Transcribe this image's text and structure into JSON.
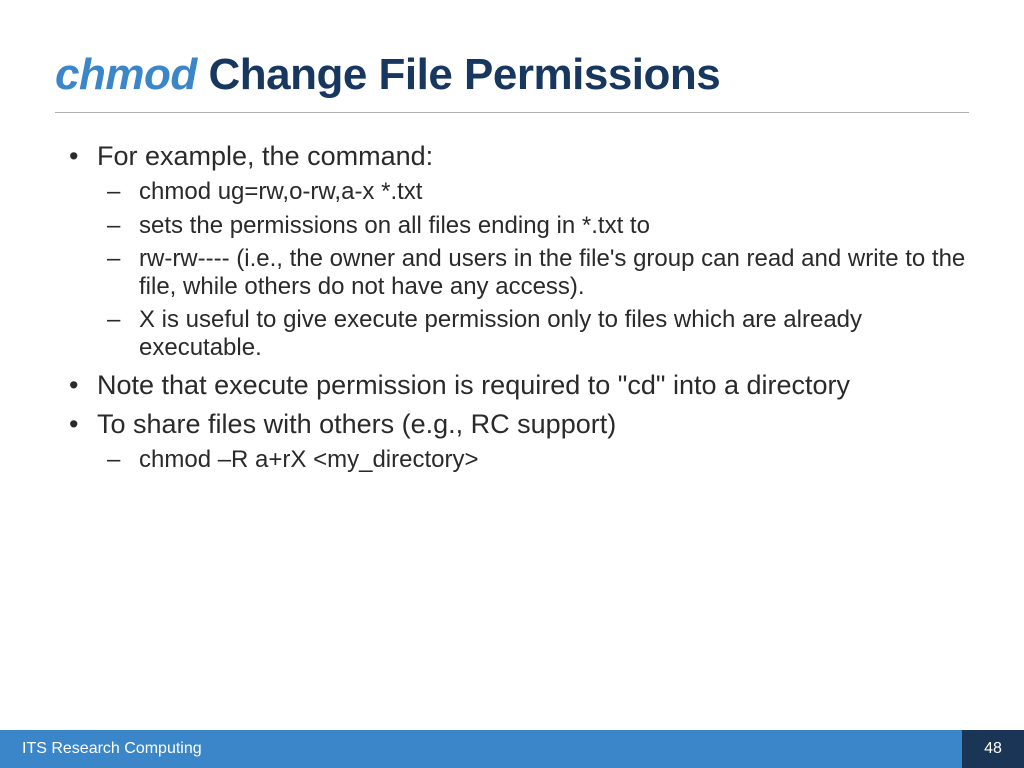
{
  "title": {
    "cmd": "chmod",
    "rest": " Change File Permissions"
  },
  "bullets": {
    "item1": {
      "text": "For example, the command:",
      "sub1": " chmod ug=rw,o-rw,a-x *.txt",
      "sub2": "sets the permissions on all files ending in *.txt to",
      "sub3": "rw-rw---- (i.e., the owner and users in the file's group can read and write to the file, while others do not have any access).",
      "sub4": "X is useful to give execute permission only to files which are already executable."
    },
    "item2": {
      "text": "Note that execute permission is required to \"cd\" into a directory"
    },
    "item3": {
      "text": "To share files with others (e.g., RC support)",
      "sub1": "chmod –R a+rX <my_directory>"
    }
  },
  "footer": {
    "org": "ITS Research Computing",
    "page": "48"
  }
}
